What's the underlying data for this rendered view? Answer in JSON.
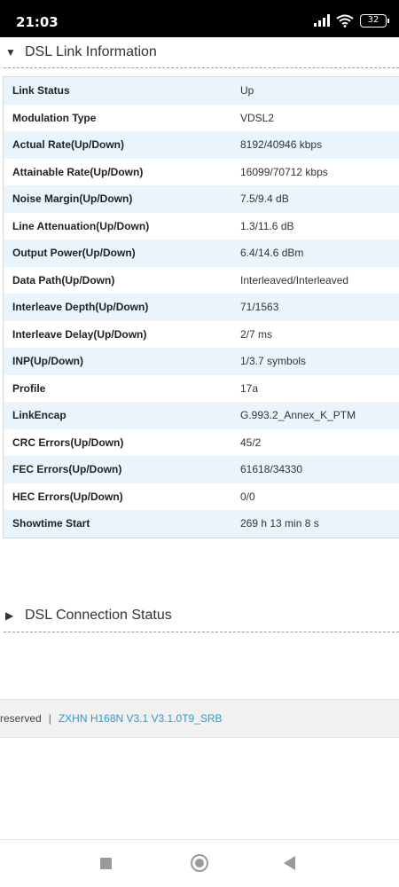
{
  "status_bar": {
    "time": "21:03",
    "battery": "32"
  },
  "dsl_link": {
    "title": "DSL Link Information",
    "rows": [
      {
        "label": "Link Status",
        "value": "Up"
      },
      {
        "label": "Modulation Type",
        "value": "VDSL2"
      },
      {
        "label": "Actual Rate(Up/Down)",
        "value": "8192/40946 kbps"
      },
      {
        "label": "Attainable Rate(Up/Down)",
        "value": "16099/70712 kbps"
      },
      {
        "label": "Noise Margin(Up/Down)",
        "value": "7.5/9.4 dB"
      },
      {
        "label": "Line Attenuation(Up/Down)",
        "value": "1.3/11.6 dB"
      },
      {
        "label": "Output Power(Up/Down)",
        "value": "6.4/14.6 dBm"
      },
      {
        "label": "Data Path(Up/Down)",
        "value": "Interleaved/Interleaved"
      },
      {
        "label": "Interleave Depth(Up/Down)",
        "value": "71/1563"
      },
      {
        "label": "Interleave Delay(Up/Down)",
        "value": "2/7 ms"
      },
      {
        "label": "INP(Up/Down)",
        "value": "1/3.7 symbols"
      },
      {
        "label": "Profile",
        "value": "17a"
      },
      {
        "label": "LinkEncap",
        "value": "G.993.2_Annex_K_PTM"
      },
      {
        "label": "CRC Errors(Up/Down)",
        "value": "45/2"
      },
      {
        "label": "FEC Errors(Up/Down)",
        "value": "61618/34330"
      },
      {
        "label": "HEC Errors(Up/Down)",
        "value": "0/0"
      },
      {
        "label": "Showtime Start",
        "value": "269 h 13 min 8 s"
      }
    ]
  },
  "dsl_connection": {
    "title": "DSL Connection Status"
  },
  "footer": {
    "reserved": "reserved",
    "separator": "|",
    "version": "ZXHN H168N V3.1 V3.1.0T9_SRB"
  },
  "icons": {
    "collapse": "triangle-down-icon",
    "expand": "triangle-right-icon",
    "signal": "signal-icon",
    "wifi": "wifi-icon",
    "battery": "battery-icon",
    "nav_recent": "square-icon",
    "nav_home": "circle-icon",
    "nav_back": "back-triangle-icon"
  },
  "colors": {
    "row_alt": "#eaf4fd",
    "link": "#2a9bd0",
    "status_bar": "#000000"
  }
}
